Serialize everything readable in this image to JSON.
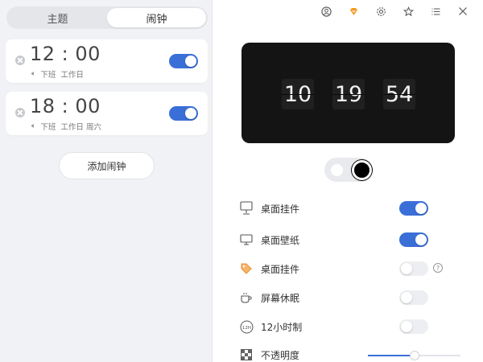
{
  "tabs": {
    "theme": "主题",
    "alarm": "闹钟"
  },
  "alarms": [
    {
      "time": "12 : 00",
      "label": "下班",
      "days": "工作日",
      "enabled": true
    },
    {
      "time": "18 : 00",
      "label": "下班",
      "days": "工作日 周六",
      "enabled": true
    }
  ],
  "add_alarm_label": "添加闹钟",
  "clock": {
    "hour": "10",
    "minute": "19",
    "second": "54"
  },
  "settings": [
    {
      "label": "桌面挂件",
      "enabled": true
    },
    {
      "label": "桌面壁纸",
      "enabled": true
    },
    {
      "label": "桌面挂件",
      "enabled": false
    },
    {
      "label": "屏幕休眠",
      "enabled": false
    },
    {
      "label": "12小时制",
      "enabled": false
    },
    {
      "label": "不透明度"
    }
  ],
  "opacity_level": 0.5,
  "help_glyph": "?",
  "twelve_hour_badge": "12H",
  "colors": {
    "accent": "#3a6fd8",
    "vip": "#f39a20",
    "clock_bg": "#141414"
  }
}
